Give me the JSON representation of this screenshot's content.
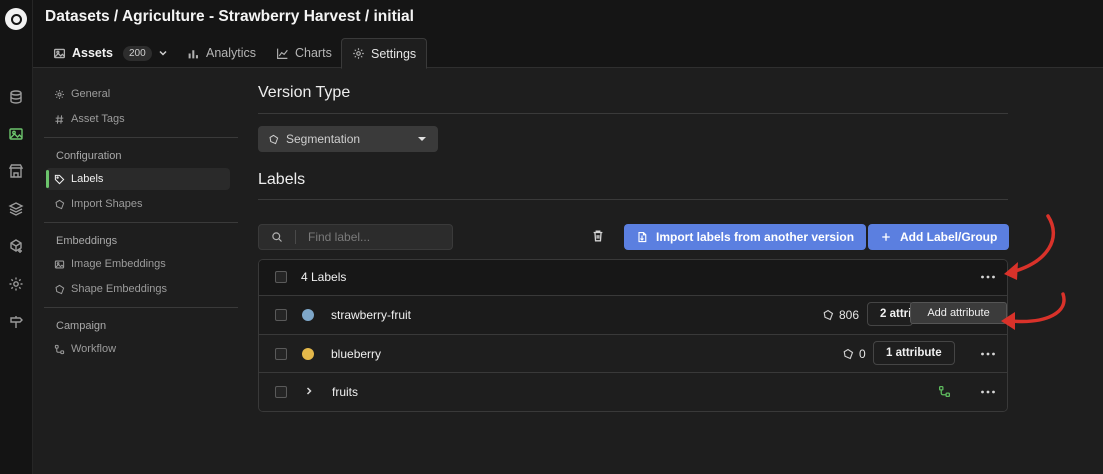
{
  "header": {
    "breadcrumb": "Datasets / Agriculture - Strawberry Harvest / initial",
    "tabs": [
      {
        "label": "Assets",
        "badge": "200",
        "icon": "image-icon"
      },
      {
        "label": "Analytics",
        "icon": "bar-chart-icon"
      },
      {
        "label": "Charts",
        "icon": "line-chart-icon"
      },
      {
        "label": "Settings",
        "icon": "gear-icon"
      }
    ]
  },
  "rail": {
    "icons": [
      "database-icon",
      "image-icon",
      "storefront-icon",
      "layers-icon",
      "cube-plus-icon",
      "gear-icon",
      "signpost-icon"
    ],
    "active": "image-icon",
    "active_color": "#6cc46c"
  },
  "sidebar": {
    "items": [
      {
        "label": "General",
        "icon": "gear-icon"
      },
      {
        "label": "Asset Tags",
        "icon": "hash-icon"
      }
    ],
    "sections": [
      {
        "heading": "Configuration",
        "items": [
          {
            "label": "Labels",
            "icon": "tag-icon",
            "active": true
          },
          {
            "label": "Import Shapes",
            "icon": "polygon-icon"
          }
        ]
      },
      {
        "heading": "Embeddings",
        "items": [
          {
            "label": "Image Embeddings",
            "icon": "image-icon"
          },
          {
            "label": "Shape Embeddings",
            "icon": "polygon-icon"
          }
        ]
      },
      {
        "heading": "Campaign",
        "items": [
          {
            "label": "Workflow",
            "icon": "workflow-icon"
          }
        ]
      }
    ]
  },
  "main": {
    "version_type_title": "Version Type",
    "version_type_value": "Segmentation",
    "labels_title": "Labels",
    "search_placeholder": "Find label...",
    "import_button": "Import labels from another version",
    "add_button": "Add Label/Group",
    "table": {
      "header": "4 Labels",
      "rows": [
        {
          "name": "strawberry-fruit",
          "color": "#7ea7c9",
          "count": "806",
          "attributes": "2 attributes"
        },
        {
          "name": "blueberry",
          "color": "#e4b84a",
          "count": "0",
          "attributes": "1 attribute"
        },
        {
          "name": "fruits",
          "type": "group",
          "icon": "workflow-icon",
          "icon_color": "#5db95d"
        }
      ]
    },
    "tooltip": "Add attribute",
    "annotation_color": "#d9322a"
  }
}
